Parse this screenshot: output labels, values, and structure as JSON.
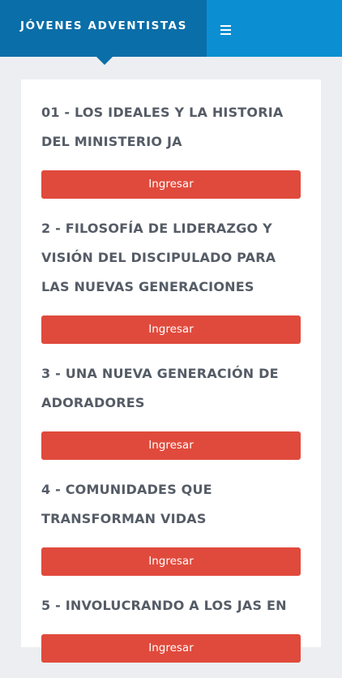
{
  "header": {
    "brand_title": "JÓVENES ADVENTISTAS",
    "menu_icon": "hamburger-menu-icon",
    "colors": {
      "bar": "#0b8fd2",
      "brand": "#0a6ea8"
    }
  },
  "modules": [
    {
      "title": "01 - LOS IDEALES Y LA HISTORIA DEL MINISTERIO JA",
      "button_label": "Ingresar"
    },
    {
      "title": "2 - FILOSOFÍA DE LIDERAZGO Y VISIÓN DEL DISCIPULADO PARA LAS NUEVAS GENERACIONES",
      "button_label": "Ingresar"
    },
    {
      "title": "3 - UNA NUEVA GENERACIÓN DE ADORADORES",
      "button_label": "Ingresar"
    },
    {
      "title": "4 - COMUNIDADES QUE TRANSFORMAN VIDAS",
      "button_label": "Ingresar"
    },
    {
      "title": "5 - INVOLUCRANDO A LOS JAS EN",
      "button_label": "Ingresar"
    }
  ],
  "colors": {
    "button": "#e04a3c",
    "title_text": "#555c66",
    "page_background": "#eceef1"
  }
}
